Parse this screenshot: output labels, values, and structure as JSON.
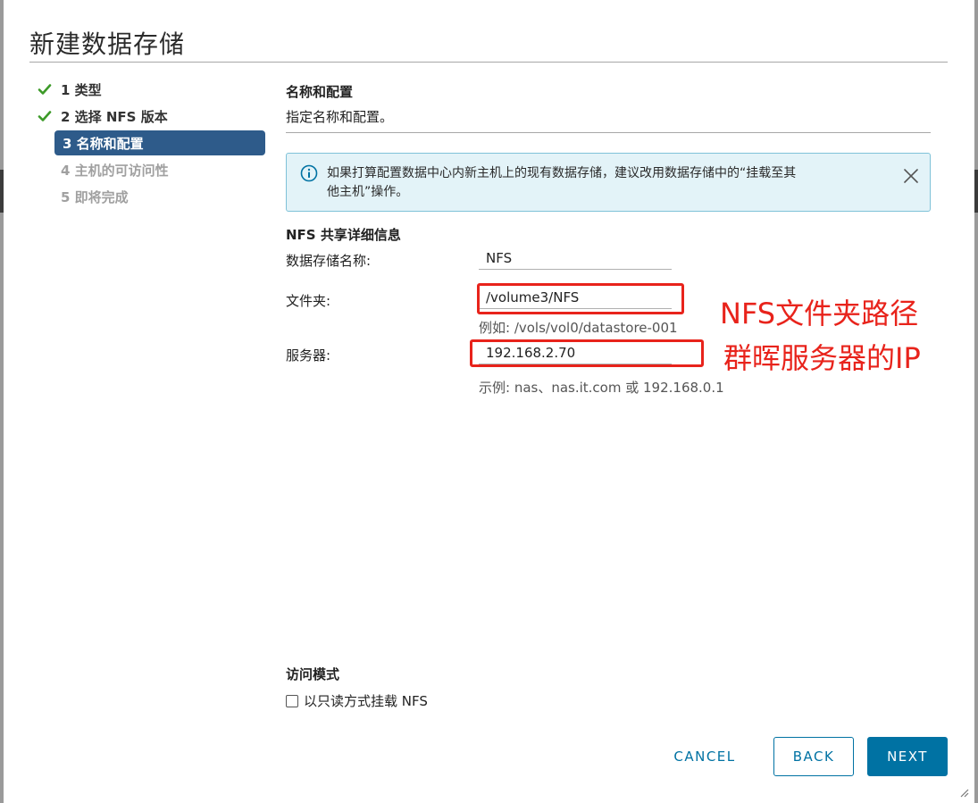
{
  "dialog": {
    "title": "新建数据存储"
  },
  "steps": [
    {
      "label": "1 类型",
      "state": "done"
    },
    {
      "label": "2 选择 NFS 版本",
      "state": "done"
    },
    {
      "label": "3 名称和配置",
      "state": "current"
    },
    {
      "label": "4 主机的可访问性",
      "state": "future"
    },
    {
      "label": "5 即将完成",
      "state": "future"
    }
  ],
  "section": {
    "title": "名称和配置",
    "subtitle": "指定名称和配置。"
  },
  "alert": {
    "line1": "如果打算配置数据中心内新主机上的现有数据存储，建议改用数据存储中的“挂载至其",
    "line2": "他主机”操作。"
  },
  "nfs": {
    "group_title": "NFS 共享详细信息",
    "name_label": "数据存储名称:",
    "name_value": "NFS",
    "folder_label": "文件夹:",
    "folder_value": "/volume3/NFS",
    "folder_hint": "例如: /vols/vol0/datastore-001",
    "server_label": "服务器:",
    "server_value": "192.168.2.70",
    "server_hint": "示例: nas、nas.it.com 或 192.168.0.1"
  },
  "annotations": {
    "folder_note": "NFS文件夹路径",
    "server_note": "群晖服务器的IP",
    "color": "#e8231b"
  },
  "access": {
    "title": "访问模式",
    "readonly_label": "以只读方式挂载 NFS",
    "readonly_checked": false
  },
  "buttons": {
    "cancel": "CANCEL",
    "back": "BACK",
    "next": "NEXT"
  },
  "colors": {
    "primary": "#0072a3",
    "current_step": "#2e5b8a",
    "check": "#3c9a28",
    "info": "#0072a3"
  }
}
